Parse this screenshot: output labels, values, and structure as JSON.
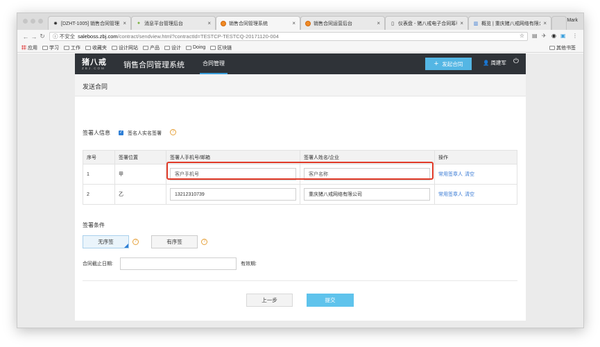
{
  "browser": {
    "profile": "Mark",
    "tabs": [
      {
        "label": "[DZHT-1005] 销售合同管理系",
        "icon": "ticket-icon"
      },
      {
        "label": "消息平台管理后台",
        "icon": "leaf-icon"
      },
      {
        "label": "销售合同管理系统",
        "icon": "orange-dot-icon"
      },
      {
        "label": "销售合同运营后台",
        "icon": "orange-dot-icon"
      },
      {
        "label": "仪表盘 - 猪八戒电子合同筹私",
        "icon": "page-icon"
      },
      {
        "label": "概览 | 重庆猪八戒网络有限公",
        "icon": "chart-icon"
      }
    ],
    "address": {
      "insecure_label": "ⓘ 不安全",
      "domain": "saleboss.zbj.com",
      "path": "/contract/sendview.html?contractId=TESTCP-TESTCQ-20171120-004"
    },
    "bookmarks": [
      "应用",
      "学习",
      "工作",
      "收藏夹",
      "设计网站",
      "产品",
      "设计",
      "Doing",
      "区块链"
    ],
    "other_bookmarks": "其他书签"
  },
  "header": {
    "logo": "猪八戒",
    "logo_sub": "ZBJ.COM",
    "system_name": "销售合同管理系统",
    "nav_tab": "合同管理",
    "launch_button": "发起合同",
    "user_name": "周建军"
  },
  "main": {
    "page_title": "发送合同",
    "signer_info_label": "签署人信息",
    "realname_checkbox_label": "签名人实名签署",
    "table": {
      "headers": [
        "序号",
        "签署位置",
        "签署人手机号/邮箱",
        "签署人姓名/企业",
        "操作"
      ],
      "rows": [
        {
          "no": "1",
          "position": "甲",
          "phone_placeholder": "客户手机号",
          "phone_value": "",
          "name_placeholder": "客户名称",
          "name_value": "",
          "op1": "常用签章人",
          "op2": "清空"
        },
        {
          "no": "2",
          "position": "乙",
          "phone_placeholder": "",
          "phone_value": "13212310739",
          "name_placeholder": "",
          "name_value": "重庆猪八戒网络有限公司",
          "op1": "常用签章人",
          "op2": "清空"
        }
      ]
    },
    "sign_condition_label": "签署条件",
    "order_options": [
      "无序签",
      "有序签"
    ],
    "deadline_label": "合同截止日期:",
    "validity_label": "有效期:",
    "prev_button": "上一步",
    "submit_button": "提交"
  }
}
